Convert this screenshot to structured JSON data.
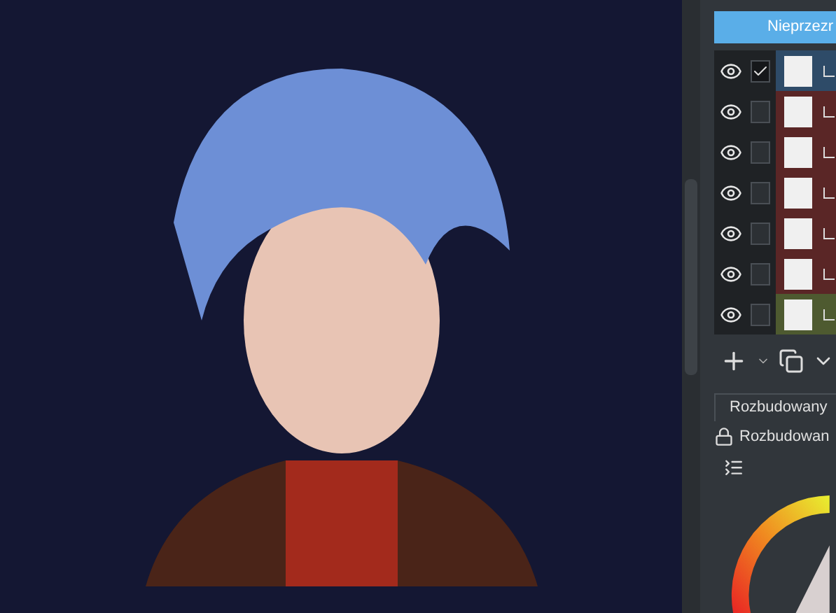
{
  "layers_panel": {
    "blend_mode": "Nieprzezr",
    "layers": [
      {
        "visible": true,
        "checked": true,
        "color": "#2e4b68"
      },
      {
        "visible": true,
        "checked": false,
        "color": "#5a2626"
      },
      {
        "visible": true,
        "checked": false,
        "color": "#5a2626"
      },
      {
        "visible": true,
        "checked": false,
        "color": "#5a2626"
      },
      {
        "visible": true,
        "checked": false,
        "color": "#5a2626"
      },
      {
        "visible": true,
        "checked": false,
        "color": "#5a2626"
      },
      {
        "visible": true,
        "checked": false,
        "color": "#4e5a30"
      }
    ]
  },
  "color_panel": {
    "tab": "Rozbudowany",
    "selector": "Rozbudowan"
  }
}
